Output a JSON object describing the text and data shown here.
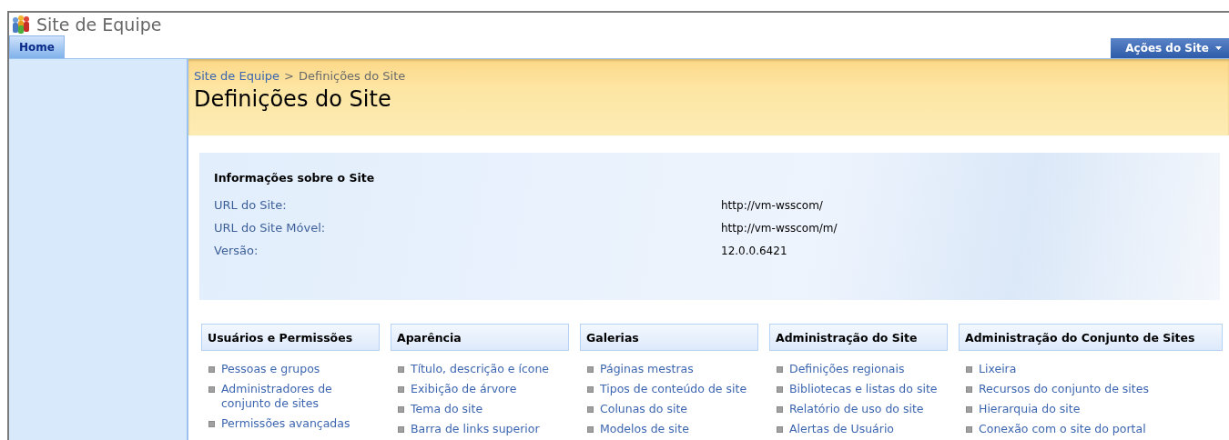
{
  "site_title": "Site de Equipe",
  "nav": {
    "tabs": [
      {
        "label": "Home",
        "selected": true
      }
    ],
    "actions_menu": "Ações do Site"
  },
  "breadcrumb": {
    "link": "Site de Equipe",
    "separator": ">",
    "current": "Definições do Site"
  },
  "page_title": "Definições do Site",
  "site_info": {
    "heading": "Informações sobre o Site",
    "rows": [
      {
        "label": "URL do Site:",
        "value": "http://vm-wsscom/"
      },
      {
        "label": "URL do Site Móvel:",
        "value": "http://vm-wsscom/m/"
      },
      {
        "label": "Versão:",
        "value": "12.0.0.6421"
      }
    ]
  },
  "sections": [
    {
      "heading": "Usuários e Permissões",
      "links": [
        "Pessoas e grupos",
        "Administradores de conjunto de sites",
        "Permissões avançadas"
      ]
    },
    {
      "heading": "Aparência",
      "links": [
        "Título, descrição e ícone",
        "Exibição de árvore",
        "Tema do site",
        "Barra de links superior"
      ]
    },
    {
      "heading": "Galerias",
      "links": [
        "Páginas mestras",
        "Tipos de conteúdo de site",
        "Colunas do site",
        "Modelos de site"
      ]
    },
    {
      "heading": "Administração do Site",
      "links": [
        "Definições regionais",
        "Bibliotecas e listas do site",
        "Relatório de uso do site",
        "Alertas de Usuário"
      ]
    },
    {
      "heading": "Administração do Conjunto de Sites",
      "links": [
        "Lixeira",
        "Recursos do conjunto de sites",
        "Hierarquia do site",
        "Conexão com o site do portal"
      ]
    }
  ]
}
